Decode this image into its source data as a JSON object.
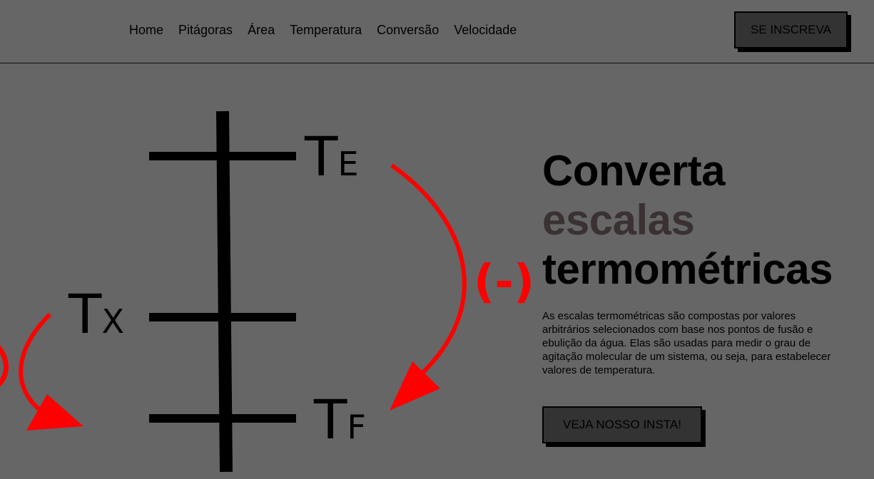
{
  "nav": {
    "items": [
      "Home",
      "Pitágoras",
      "Área",
      "Temperatura",
      "Conversão",
      "Velocidade"
    ]
  },
  "header": {
    "subscribe_label": "SE INSCREVA"
  },
  "hero": {
    "title_line1": "Converta",
    "title_line2": "escalas",
    "title_line3": "termométricas",
    "description": "As escalas termométricas são compostas por valores arbitrários selecionados com base nos pontos de fusão e ebulição da água. Elas são usadas para medir o grau de agitação molecular de um sistema, ou seja, para estabelecer valores de temperatura.",
    "cta_label": "VEJA NOSSO INSTA!"
  },
  "diagram": {
    "label_top": "T",
    "label_top_sub": "E",
    "label_mid": "T",
    "label_mid_sub": "X",
    "label_bottom": "T",
    "label_bottom_sub": "F",
    "minus_sign": "(-)"
  },
  "colors": {
    "background": "#666666",
    "button_bg": "#333333",
    "accent_text": "#3a3232",
    "arrow_red": "#ff0000"
  }
}
